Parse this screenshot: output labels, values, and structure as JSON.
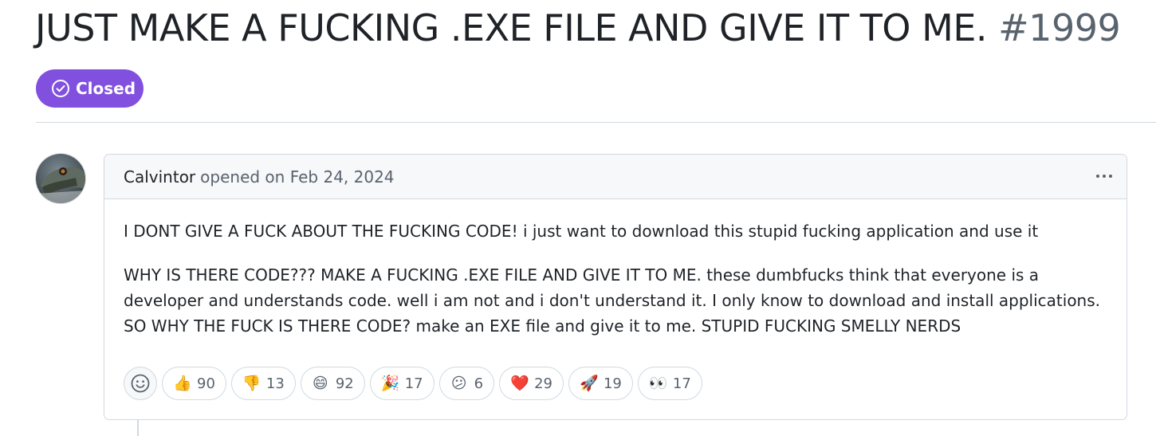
{
  "issue": {
    "title": "JUST MAKE A FUCKING .EXE FILE AND GIVE IT TO ME.",
    "number": "#1999",
    "state": "Closed"
  },
  "comment": {
    "author": "Calvintor",
    "meta": "opened on Feb 24, 2024",
    "paragraphs": [
      "I DONT GIVE A FUCK ABOUT THE FUCKING CODE! i just want to download this stupid fucking application and use it",
      "WHY IS THERE CODE??? MAKE A FUCKING .EXE FILE AND GIVE IT TO ME. these dumbfucks think that everyone is a developer and understands code. well i am not and i don't understand it. I only know to download and install applications. SO WHY THE FUCK IS THERE CODE? make an EXE file and give it to me. STUPID FUCKING SMELLY NERDS"
    ]
  },
  "reactions": [
    {
      "emoji": "👍",
      "icon": "thumbs-up-icon",
      "count": "90"
    },
    {
      "emoji": "👎",
      "icon": "thumbs-down-icon",
      "count": "13"
    },
    {
      "emoji": "😄",
      "icon": "laugh-icon",
      "count": "92"
    },
    {
      "emoji": "🎉",
      "icon": "hooray-icon",
      "count": "17"
    },
    {
      "emoji": "😕",
      "icon": "confused-icon",
      "count": "6"
    },
    {
      "emoji": "❤️",
      "icon": "heart-icon",
      "count": "29"
    },
    {
      "emoji": "🚀",
      "icon": "rocket-icon",
      "count": "19"
    },
    {
      "emoji": "👀",
      "icon": "eyes-icon",
      "count": "17"
    }
  ],
  "colors": {
    "closed_badge": "#8250df",
    "border": "#d1d9e0",
    "muted_text": "#59636e"
  }
}
